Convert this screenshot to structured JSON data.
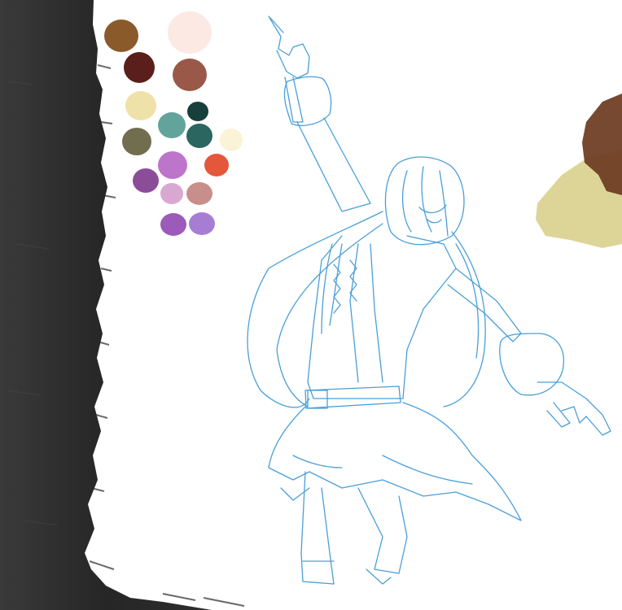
{
  "canvas": {
    "background": "#ffffff",
    "edge_brush_color": "#2a2a2a"
  },
  "palette": {
    "swatches": [
      {
        "name": "brown",
        "color": "#8b5a2b"
      },
      {
        "name": "skin-pale",
        "color": "#fde9e4"
      },
      {
        "name": "dark-red-brown",
        "color": "#5a1f1a"
      },
      {
        "name": "copper-brown",
        "color": "#9a5848"
      },
      {
        "name": "pale-yellow",
        "color": "#efe2a8"
      },
      {
        "name": "dark-teal",
        "color": "#173f3b"
      },
      {
        "name": "teal",
        "color": "#62a39b"
      },
      {
        "name": "olive",
        "color": "#716d4f"
      },
      {
        "name": "deep-teal",
        "color": "#2b6660"
      },
      {
        "name": "cream",
        "color": "#fbf3d7"
      },
      {
        "name": "orchid",
        "color": "#bd74cb"
      },
      {
        "name": "red-orange",
        "color": "#e5573a"
      },
      {
        "name": "purple",
        "color": "#8c4d98"
      },
      {
        "name": "light-pink-lilac",
        "color": "#d9a8d2"
      },
      {
        "name": "dusty-rose",
        "color": "#c88e8b"
      },
      {
        "name": "violet",
        "color": "#9c5bb8"
      },
      {
        "name": "lavender",
        "color": "#a77dd4"
      }
    ]
  },
  "sketch": {
    "line_color": "#4a9fd8",
    "subject": "character-lineart"
  },
  "paint_strokes": {
    "brown": "#6b3a1f",
    "yellow": "#d9cf8c"
  }
}
